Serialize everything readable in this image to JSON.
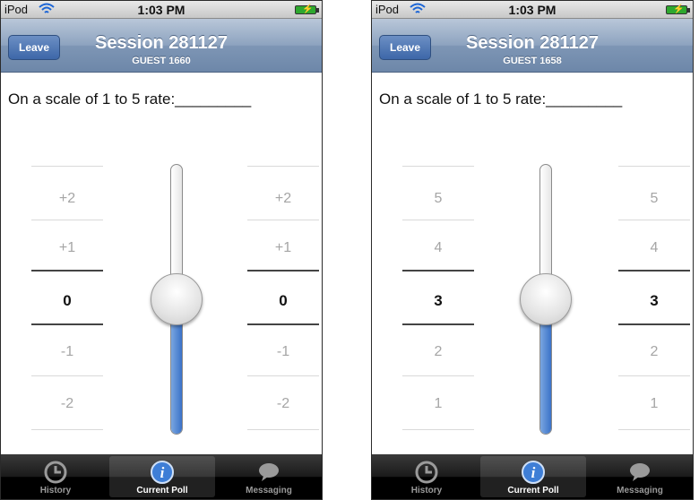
{
  "screens": [
    {
      "status": {
        "carrier": "iPod",
        "time": "1:03 PM"
      },
      "nav": {
        "leave_label": "Leave",
        "title": "Session 281127",
        "subtitle": "GUEST 1660"
      },
      "prompt": "On a scale of 1 to 5 rate:_________",
      "scale": {
        "values": [
          "+2",
          "+1",
          "0",
          "-1",
          "-2"
        ],
        "selected_index": 2,
        "slider_level": 0.5
      },
      "tabs": [
        {
          "label": "History",
          "icon": "clock-icon",
          "active": false
        },
        {
          "label": "Current Poll",
          "icon": "info-icon",
          "active": true
        },
        {
          "label": "Messaging",
          "icon": "chat-bubble-icon",
          "active": false
        }
      ]
    },
    {
      "status": {
        "carrier": "iPod",
        "time": "1:03 PM"
      },
      "nav": {
        "leave_label": "Leave",
        "title": "Session 281127",
        "subtitle": "GUEST 1658"
      },
      "prompt": "On a scale of 1 to 5 rate:_________",
      "scale": {
        "values": [
          "5",
          "4",
          "3",
          "2",
          "1"
        ],
        "selected_index": 2,
        "slider_level": 0.5
      },
      "tabs": [
        {
          "label": "History",
          "icon": "clock-icon",
          "active": false
        },
        {
          "label": "Current Poll",
          "icon": "info-icon",
          "active": true
        },
        {
          "label": "Messaging",
          "icon": "chat-bubble-icon",
          "active": false
        }
      ]
    }
  ],
  "colors": {
    "accent": "#3a72c8",
    "nav": "#7e96b5",
    "tabbar": "#000000"
  }
}
